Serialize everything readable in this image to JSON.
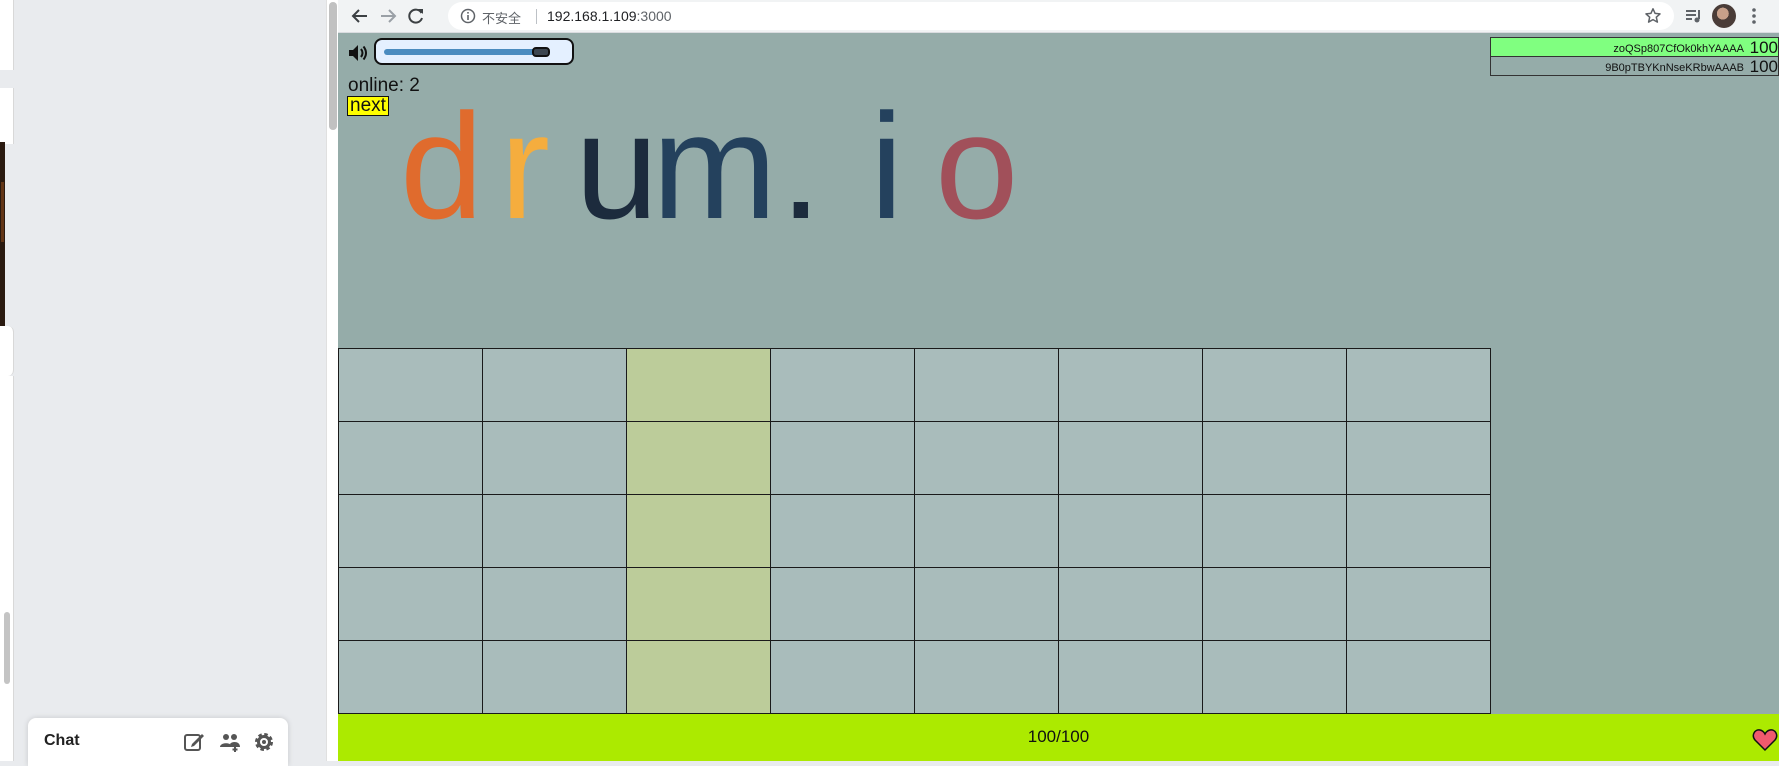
{
  "browser": {
    "security_label": "不安全",
    "url_host": "192.168.1.109",
    "url_port": ":3000"
  },
  "chat": {
    "label": "Chat"
  },
  "game": {
    "online_label": "online: 2",
    "next_label": "next",
    "logo_letters": [
      {
        "char": "d",
        "color": "#e06b2d"
      },
      {
        "char": "r",
        "color": "#f5ad3e"
      },
      {
        "char": "u",
        "color": "#1c2b3d"
      },
      {
        "char": "m",
        "color": "#24415d"
      },
      {
        "char": ".",
        "color": "#1c2b3d"
      },
      {
        "char": "i",
        "color": "#24415d"
      },
      {
        "char": "o",
        "color": "#a1505a"
      }
    ],
    "volume_level": 0.9,
    "leaderboard": [
      {
        "name": "zoQSp807CfOk0khYAAAA",
        "score": "100",
        "highlight": true,
        "color": "#80ff80"
      },
      {
        "name": "9B0pTBYKnNseKRbwAAAB",
        "score": "100",
        "highlight": false,
        "color": "#95aca9"
      }
    ],
    "grid": {
      "columns": 8,
      "rows": 5,
      "active_column": 2
    },
    "health_text": "100/100"
  },
  "colors": {
    "game_background": "#95aca9",
    "cell": "#a9bcbb",
    "active_cell": "#bccc9a",
    "health_bar": "#acea00",
    "next_button": "#ffff00",
    "heart": "#f05a6e"
  }
}
